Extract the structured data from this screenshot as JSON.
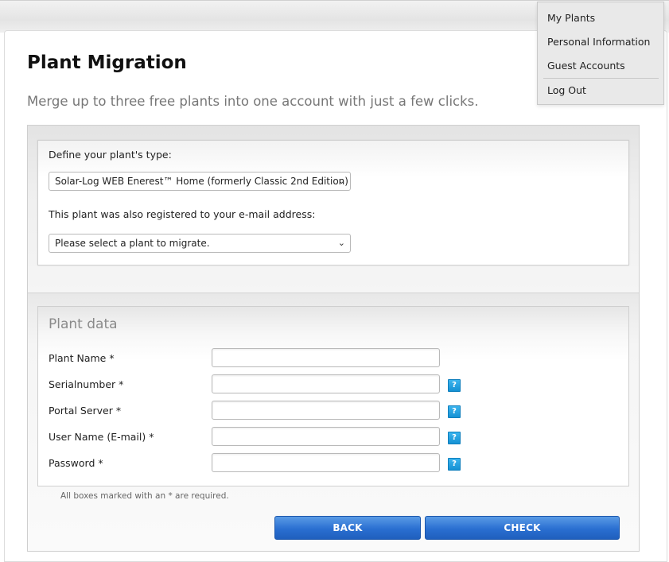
{
  "page": {
    "title": "Plant Migration",
    "subtitle": "Merge up to three free plants into one account with just a few clicks."
  },
  "type_section": {
    "type_label": "Define your plant's type:",
    "type_select_value": "Solar-Log WEB Enerest™ Home (formerly Classic 2nd Edition)",
    "registered_label": "This plant was also registered to your e-mail address:",
    "plant_select_value": "Please select a plant to migrate."
  },
  "plant_data": {
    "title": "Plant data",
    "fields": [
      {
        "label": "Plant Name *",
        "value": "",
        "help": false
      },
      {
        "label": "Serialnumber *",
        "value": "",
        "help": true
      },
      {
        "label": "Portal Server *",
        "value": "",
        "help": true
      },
      {
        "label": "User Name (E-mail) *",
        "value": "",
        "help": true
      },
      {
        "label": "Password *",
        "value": "",
        "help": true
      }
    ],
    "help_glyph": "?",
    "required_note": "All boxes marked with an * are required."
  },
  "buttons": {
    "back": "BACK",
    "check": "CHECK"
  },
  "user_menu": {
    "items": [
      "My Plants",
      "Personal Information",
      "Guest Accounts",
      "Log Out"
    ]
  },
  "colors": {
    "button_blue": "#2a6fd1",
    "help_blue": "#1591d3",
    "subtitle_gray": "#777777"
  },
  "icons": {
    "select_chevron": "chevron-down-icon",
    "help": "help-icon"
  }
}
